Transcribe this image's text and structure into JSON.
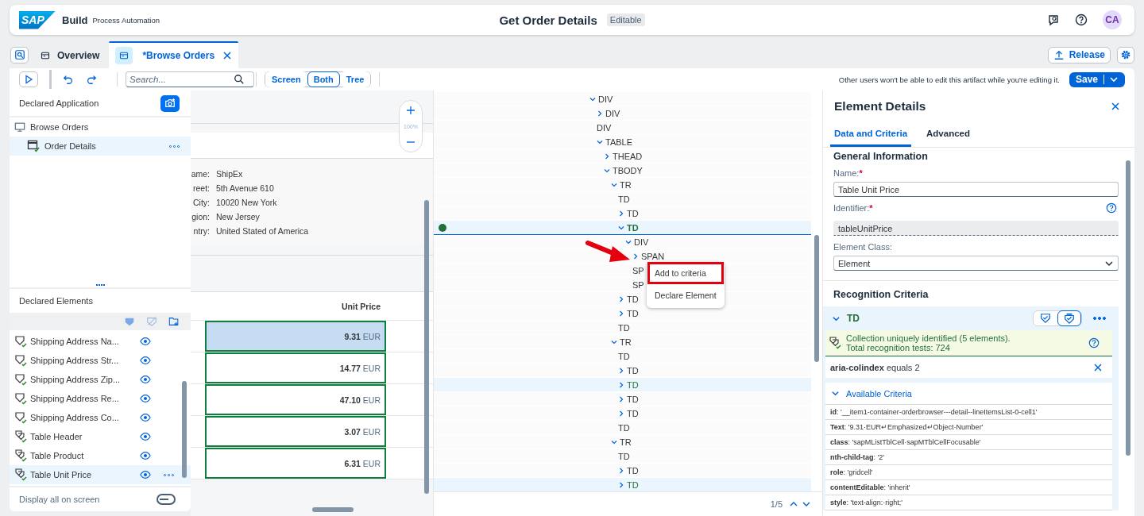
{
  "header": {
    "logo": "SAP",
    "product": "Build",
    "subtitle": "Process Automation",
    "title": "Get Order Details",
    "badge": "Editable",
    "avatar": "CA"
  },
  "tabs": [
    {
      "label": "Overview",
      "selected": false,
      "closable": false
    },
    {
      "label": "*Browse Orders",
      "selected": true,
      "closable": true
    }
  ],
  "release_button": "Release",
  "toolbar": {
    "search": {
      "placeholder": "Search..."
    },
    "view_modes": [
      {
        "label": "Screen",
        "selected": false
      },
      {
        "label": "Both",
        "selected": true
      },
      {
        "label": "Tree",
        "selected": false
      }
    ],
    "notice": "Other users won't be able to edit this artifact while you're editing it.",
    "save_button": "Save"
  },
  "declared_application": {
    "title": "Declared Application",
    "items": [
      {
        "label": "Browse Orders",
        "kind": "screen",
        "selected": false,
        "children": [
          {
            "label": "Order Details",
            "kind": "page",
            "selected": true
          }
        ]
      }
    ]
  },
  "declared_elements": {
    "title": "Declared Elements",
    "items": [
      {
        "label": "Shipping Address Na...",
        "kind": "element",
        "selected": false
      },
      {
        "label": "Shipping Address Str...",
        "kind": "element",
        "selected": false
      },
      {
        "label": "Shipping Address Zip...",
        "kind": "element",
        "selected": false
      },
      {
        "label": "Shipping Address Re...",
        "kind": "element",
        "selected": false
      },
      {
        "label": "Shipping Address Co...",
        "kind": "element",
        "selected": false
      },
      {
        "label": "Table Header",
        "kind": "collection",
        "selected": false
      },
      {
        "label": "Table Product",
        "kind": "collection",
        "selected": false
      },
      {
        "label": "Table Unit Price",
        "kind": "collection",
        "selected": true
      }
    ],
    "display_all": {
      "label": "Display all on screen",
      "on": false
    }
  },
  "screen_preview": {
    "zoom": "100%",
    "fields": [
      {
        "label": "ame:",
        "value": "ShipEx"
      },
      {
        "label": "reet:",
        "value": "5th Avenue 610"
      },
      {
        "label": "City:",
        "value": "10020 New York"
      },
      {
        "label": "gion:",
        "value": "New Jersey"
      },
      {
        "label": "ntry:",
        "value": "United Stated of America"
      }
    ],
    "table": {
      "column": "Unit Price",
      "rows": [
        {
          "amount": "9.31",
          "currency": "EUR",
          "selected": true
        },
        {
          "amount": "14.77",
          "currency": "EUR",
          "selected": false
        },
        {
          "amount": "47.10",
          "currency": "EUR",
          "selected": false
        },
        {
          "amount": "3.07",
          "currency": "EUR",
          "selected": false
        },
        {
          "amount": "6.31",
          "currency": "EUR",
          "selected": false
        }
      ]
    }
  },
  "dom_tree": {
    "nodes": [
      {
        "tag": "DIV",
        "kind": "node",
        "expanded": true,
        "selected": false,
        "matched": false,
        "children": [
          {
            "tag": "DIV",
            "kind": "node",
            "expanded": false,
            "selected": false,
            "matched": false
          },
          {
            "tag": "DIV",
            "kind": "leaf",
            "selected": false,
            "matched": false
          },
          {
            "tag": "TABLE",
            "kind": "node",
            "expanded": true,
            "selected": false,
            "matched": false,
            "children": [
              {
                "tag": "THEAD",
                "kind": "node",
                "expanded": false,
                "selected": false,
                "matched": false
              },
              {
                "tag": "TBODY",
                "kind": "node",
                "expanded": true,
                "selected": false,
                "matched": false,
                "children": [
                  {
                    "tag": "TR",
                    "kind": "node",
                    "expanded": true,
                    "selected": false,
                    "matched": false,
                    "children": [
                      {
                        "tag": "TD",
                        "kind": "leaf",
                        "selected": false,
                        "matched": false
                      },
                      {
                        "tag": "TD",
                        "kind": "node",
                        "expanded": false,
                        "selected": false,
                        "matched": false
                      },
                      {
                        "tag": "TD",
                        "kind": "node",
                        "expanded": true,
                        "selected": true,
                        "matched": false,
                        "children": [
                          {
                            "tag": "DIV",
                            "kind": "node",
                            "expanded": true,
                            "selected": false,
                            "matched": false,
                            "children": [
                              {
                                "tag": "SPAN",
                                "kind": "node",
                                "expanded": false,
                                "selected": false,
                                "matched": false
                              },
                              {
                                "tag": "SP",
                                "kind": "leaf",
                                "selected": false,
                                "matched": false
                              },
                              {
                                "tag": "SP",
                                "kind": "leaf",
                                "selected": false,
                                "matched": false
                              }
                            ]
                          }
                        ]
                      },
                      {
                        "tag": "TD",
                        "kind": "node",
                        "expanded": false,
                        "selected": false,
                        "matched": false
                      },
                      {
                        "tag": "TD",
                        "kind": "node",
                        "expanded": false,
                        "selected": false,
                        "matched": false
                      },
                      {
                        "tag": "TD",
                        "kind": "leaf",
                        "selected": false,
                        "matched": false
                      }
                    ]
                  },
                  {
                    "tag": "TR",
                    "kind": "node",
                    "expanded": true,
                    "selected": false,
                    "matched": false,
                    "children": [
                      {
                        "tag": "TD",
                        "kind": "leaf",
                        "selected": false,
                        "matched": false
                      },
                      {
                        "tag": "TD",
                        "kind": "node",
                        "expanded": false,
                        "selected": false,
                        "matched": false
                      },
                      {
                        "tag": "TD",
                        "kind": "node",
                        "expanded": false,
                        "selected": false,
                        "matched": true
                      },
                      {
                        "tag": "TD",
                        "kind": "node",
                        "expanded": false,
                        "selected": false,
                        "matched": false
                      },
                      {
                        "tag": "TD",
                        "kind": "node",
                        "expanded": false,
                        "selected": false,
                        "matched": false
                      },
                      {
                        "tag": "TD",
                        "kind": "leaf",
                        "selected": false,
                        "matched": false
                      }
                    ]
                  },
                  {
                    "tag": "TR",
                    "kind": "node",
                    "expanded": true,
                    "selected": false,
                    "matched": false,
                    "children": [
                      {
                        "tag": "TD",
                        "kind": "leaf",
                        "selected": false,
                        "matched": false
                      },
                      {
                        "tag": "TD",
                        "kind": "node",
                        "expanded": false,
                        "selected": false,
                        "matched": false
                      },
                      {
                        "tag": "TD",
                        "kind": "node",
                        "expanded": false,
                        "selected": false,
                        "matched": true
                      }
                    ]
                  }
                ]
              }
            ]
          }
        ]
      }
    ],
    "context_menu": [
      {
        "label": "Add to criteria",
        "highlighted": true
      },
      {
        "label": "Declare Element",
        "highlighted": false
      }
    ],
    "pager": "1/5"
  },
  "element_details": {
    "title": "Element Details",
    "tabs": [
      {
        "label": "Data and Criteria",
        "selected": true
      },
      {
        "label": "Advanced",
        "selected": false
      }
    ],
    "general": {
      "title": "General Information",
      "fields": [
        {
          "label": "Name:",
          "required_mark": "*",
          "value": "Table Unit Price",
          "kind": "input"
        },
        {
          "label": "Identifier:",
          "required_mark": "*",
          "value": "tableUnitPrice",
          "kind": "readonly"
        },
        {
          "label": "Element Class:",
          "value": "Element",
          "kind": "select"
        }
      ]
    },
    "recognition": {
      "title": "Recognition Criteria",
      "target": "TD",
      "expanded": true,
      "mode_buttons": [
        {
          "kind": "element",
          "selected": false
        },
        {
          "kind": "collection",
          "selected": true
        }
      ],
      "message": "Collection uniquely identified (5 elements).",
      "message_detail": "Total recognition tests: 724",
      "criterion": "**aria-colindex** equals 2",
      "available": {
        "title": "Available Criteria",
        "expanded": true,
        "items": [
          "**id**: '__item1-container-orderbrowser---detail--lineItemsList-0-cell1'",
          "**Text**: '9.31·EUR↵Emphasized↵Object·Number'",
          "**class**: 'sapMListTblCell·sapMTblCellFocusable'",
          "**nth-child-tag**: '2'",
          "**role**: 'gridcell'",
          "**contentEditable**: 'inherit'",
          "**style**: 'text-align:·right;'"
        ]
      }
    }
  }
}
